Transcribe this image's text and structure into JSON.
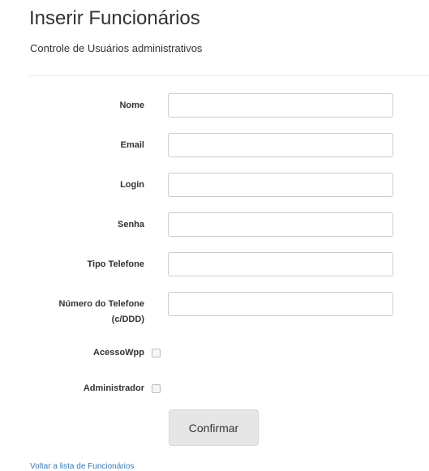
{
  "header": {
    "title": "Inserir Funcionários",
    "subtitle": "Controle de Usuários administrativos"
  },
  "form": {
    "fields": [
      {
        "label": "Nome",
        "value": ""
      },
      {
        "label": "Email",
        "value": ""
      },
      {
        "label": "Login",
        "value": ""
      },
      {
        "label": "Senha",
        "value": ""
      },
      {
        "label": "Tipo Telefone",
        "value": ""
      },
      {
        "label_line1": "Número do Telefone",
        "label_line2": "(c/DDD)",
        "value": ""
      }
    ],
    "checkboxes": [
      {
        "label": "AcessoWpp",
        "checked": false
      },
      {
        "label": "Administrador",
        "checked": false
      }
    ],
    "submit_label": "Confirmar"
  },
  "footer": {
    "back_link": "Voltar a lista de Funcionários"
  },
  "colors": {
    "link": "#337ab7",
    "button_bg": "#e6e6e6",
    "input_border": "#cccccc"
  }
}
